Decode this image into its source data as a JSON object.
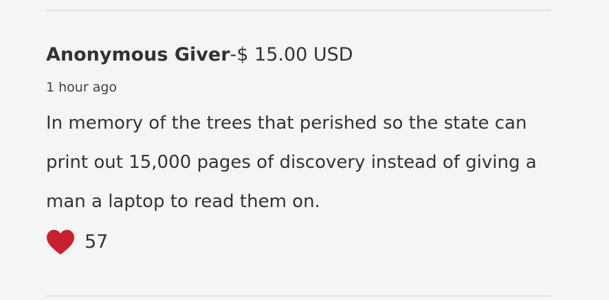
{
  "donation": {
    "donor_name": "Anonymous Giver",
    "separator": "-",
    "amount": "$ 15.00 USD",
    "time_ago": "1 hour ago",
    "message": "In memory of the trees that perished so the state can print out 15,000 pages of discovery instead of giving a man a laptop to read them on.",
    "like_count": "57",
    "like_icon": "heart-icon",
    "like_color": "#c8202e"
  }
}
